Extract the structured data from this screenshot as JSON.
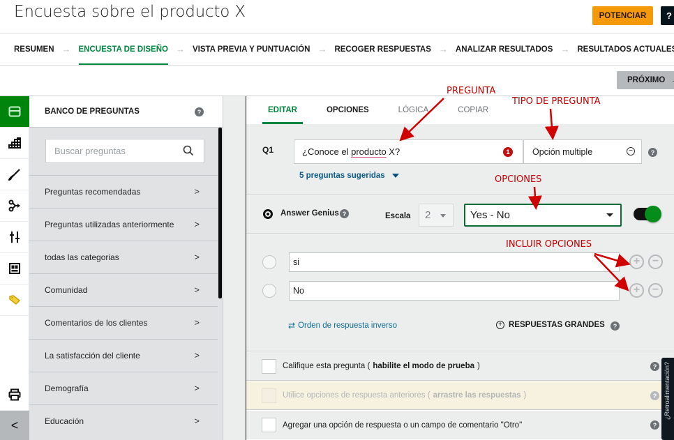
{
  "header": {
    "title": "Encuesta sobre el producto X",
    "upgrade_label": "POTENCIAR",
    "dark_button_glyph": "?"
  },
  "steps": [
    {
      "label": "RESUMEN",
      "active": false
    },
    {
      "label": "ENCUESTA DE DISEÑO",
      "active": true
    },
    {
      "label": "VISTA PREVIA Y PUNTUACIÓN",
      "active": false
    },
    {
      "label": "RECOGER RESPUESTAS",
      "active": false
    },
    {
      "label": "ANALIZAR RESULTADOS",
      "active": false
    },
    {
      "label": "RESULTADOS ACTUALES",
      "active": false
    }
  ],
  "step_separator": "→",
  "next_button": {
    "label": "PRÓXIMO",
    "arrow": "→"
  },
  "rail": {
    "items": [
      {
        "icon": "question-bank-icon",
        "active": true
      },
      {
        "icon": "builder-icon"
      },
      {
        "icon": "design-brush-icon"
      },
      {
        "icon": "logic-branch-icon"
      },
      {
        "icon": "options-sliders-icon"
      },
      {
        "icon": "layout-icon"
      },
      {
        "icon": "tag-icon"
      }
    ],
    "print_icon": "print-icon",
    "collapse_glyph": "<"
  },
  "question_bank": {
    "title": "BANCO DE PREGUNTAS",
    "help_glyph": "?",
    "search_placeholder": "Buscar preguntas",
    "items": [
      "Preguntas recomendadas",
      "Preguntas utilizadas anteriormente",
      "todas las categorias",
      "Comunidad",
      "Comentarios de los clientes",
      "La satisfacción del cliente",
      "Demografía",
      "Educación"
    ],
    "chevron": ">"
  },
  "editor": {
    "tabs": [
      {
        "label": "EDITAR",
        "state": "active"
      },
      {
        "label": "OPCIONES",
        "state": "normal"
      },
      {
        "label": "LÓGICA",
        "state": "muted"
      },
      {
        "label": "COPIAR",
        "state": "muted"
      }
    ],
    "question": {
      "number": "Q1",
      "text_before": "¿Conoce el ",
      "text_misspelled": "producto",
      "text_after": " X?",
      "error_count": "1",
      "type": "Opción multiple",
      "suggested": "5 preguntas sugeridas"
    },
    "answer_genius": {
      "label": "Answer Genius",
      "scale_label": "Escala",
      "scale_value": "2",
      "preset_value": "Yes - No",
      "toggle_on": true
    },
    "choices": [
      {
        "value": "si"
      },
      {
        "value": "No"
      }
    ],
    "add_glyph": "+",
    "remove_glyph": "−",
    "reverse_order_label": "Orden de respuesta inverso",
    "big_answers_label": "RESPUESTAS GRANDES",
    "checkbox_rows": [
      {
        "text": "Califique esta pregunta (",
        "bold": "habilite el modo de prueba",
        "end": ")",
        "disabled": false
      },
      {
        "text": "Utilice opciones de respuesta anteriores (",
        "bold": "arrastre las respuestas",
        "end": ")",
        "disabled": true
      },
      {
        "text": "Agregar una opción de respuesta o un campo de comentario \"Otro\"",
        "bold": "",
        "end": "",
        "disabled": false
      }
    ]
  },
  "side_tab_label": "¿Retroalimentación?",
  "annotations": {
    "question": "PREGUNTA",
    "question_type": "TIPO DE PREGUNTA",
    "options": "OPCIONES",
    "include_options": "INCLUIR OPCIONES"
  },
  "colors": {
    "brand_green": "#00853e",
    "rail_active": "#00840c",
    "upgrade_orange": "#f49a0a",
    "annotation_red": "#c40000",
    "link_blue": "#0c5c85"
  }
}
